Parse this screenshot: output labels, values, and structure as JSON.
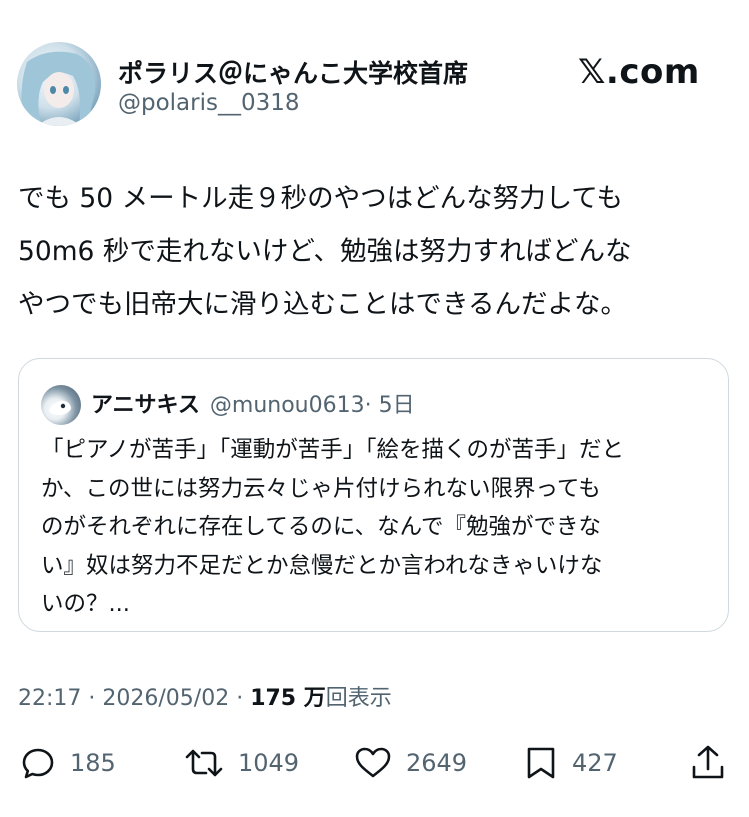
{
  "author": {
    "name": "ポラリス＠にゃんこ大学校首席",
    "handle": "@polaris__0318"
  },
  "brand": {
    "logo_x": "𝕏",
    "logo_text": ".com"
  },
  "tweet": {
    "lines": [
      "でも 50 メートル走９秒のやつはどんな努力しても",
      "50m6 秒で走れないけど、勉強は努力すればどんな",
      "やつでも旧帝大に滑り込むことはできるんだよな。"
    ]
  },
  "quote": {
    "name": "アニサキス",
    "handle": "@munou0613",
    "time": "· 5日",
    "lines": [
      "「ピアノが苦手」「運動が苦手」「絵を描くのが苦手」だと",
      "か、この世には努力云々じゃ片付けられない限界っても",
      "のがそれぞれに存在してるのに、なんで『勉強ができな",
      "い』奴は努力不足だとか怠慢だとか言われなきゃいけな",
      "いの？..."
    ]
  },
  "meta": {
    "time": "22:17",
    "sep1": " · ",
    "date": "2026/05/02",
    "sep2": " · ",
    "views": "175 万",
    "views_label": "回表示"
  },
  "actions": {
    "replies": "185",
    "reposts": "1049",
    "likes": "2649",
    "bookmarks": "427"
  },
  "colors": {
    "text": "#0f1419",
    "secondary": "#536471",
    "border": "#cfd9de"
  }
}
